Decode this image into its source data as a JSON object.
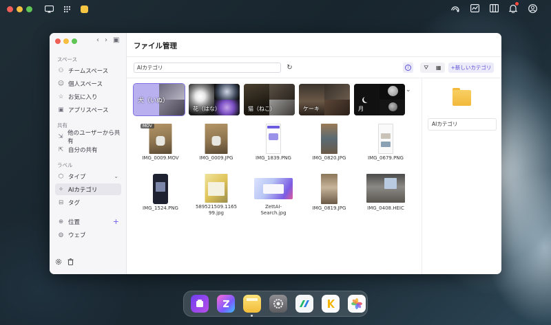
{
  "menubar": {
    "icons_left": [
      "window-icon",
      "grid-icon",
      "notes-icon"
    ],
    "icons_right": [
      "cloud-sync-icon",
      "chart-icon",
      "columns-icon",
      "bell-icon",
      "account-icon"
    ]
  },
  "window": {
    "title": "ファイル管理",
    "nav_back": "‹",
    "nav_forward": "›",
    "nav_panel": "▣"
  },
  "sidebar": {
    "spaces_header": "スペース",
    "spaces": [
      {
        "label": "チームスペース",
        "icon": "users-icon",
        "glyph": "⚇"
      },
      {
        "label": "個人スペース",
        "icon": "person-icon",
        "glyph": "☺"
      },
      {
        "label": "お気に入り",
        "icon": "star-icon",
        "glyph": "☆"
      },
      {
        "label": "アプリスペース",
        "icon": "app-icon",
        "glyph": "▣"
      }
    ],
    "shared_header": "共有",
    "shared": [
      {
        "label": "他のユーザーから共有",
        "icon": "share-in-icon",
        "glyph": "⇲"
      },
      {
        "label": "自分の共有",
        "icon": "share-out-icon",
        "glyph": "⇱"
      }
    ],
    "label_header": "ラベル",
    "labels": [
      {
        "label": "タイプ",
        "icon": "type-icon",
        "glyph": "⬡",
        "suffix": "⌄"
      },
      {
        "label": "AIカテゴリ",
        "icon": "ai-sparkle-icon",
        "glyph": "✧"
      },
      {
        "label": "タグ",
        "icon": "tag-icon",
        "glyph": "⊟"
      }
    ],
    "locations": [
      {
        "label": "位置",
        "icon": "location-icon",
        "glyph": "⊕",
        "suffix": "+"
      },
      {
        "label": "ウェブ",
        "icon": "globe-icon",
        "glyph": "◍"
      }
    ],
    "bottom_icons": [
      "settings-icon",
      "trash-icon"
    ]
  },
  "toolbar": {
    "search_value": "AIカテゴリ",
    "reload_glyph": "↻",
    "info_glyph": "i",
    "filter_glyph": "⛛",
    "grid_glyph": "▦",
    "new_category_label": "+新しいカテゴリ"
  },
  "categories": [
    {
      "label": "犬（いぬ）",
      "selected": true
    },
    {
      "label": "花（はな）",
      "selected": false
    },
    {
      "label": "猫（ねこ）",
      "selected": false
    },
    {
      "label": "ケーキ",
      "selected": false
    },
    {
      "label": "月",
      "selected": false
    }
  ],
  "categories_more": "⌄",
  "files": [
    {
      "name": "IMG_0009.MOV",
      "badge": "MOV",
      "kind": "dog-photo"
    },
    {
      "name": "IMG_0009.JPG",
      "kind": "dog-photo"
    },
    {
      "name": "IMG_1839.PNG",
      "kind": "screenshot"
    },
    {
      "name": "IMG_0820.JPG",
      "kind": "portrait-photo"
    },
    {
      "name": "IMG_0679.PNG",
      "kind": "screenshot"
    },
    {
      "name": "IMG_1524.PNG",
      "kind": "phone-dark"
    },
    {
      "name": "589521509.1165\n99.jpg",
      "kind": "document-photo"
    },
    {
      "name": "ZettAI-\nSearch.jpg",
      "kind": "web-banner"
    },
    {
      "name": "IMG_0819.JPG",
      "kind": "portrait-photo"
    },
    {
      "name": "IMG_0408.HEIC",
      "kind": "room-photo"
    }
  ],
  "detail": {
    "name_value": "AIカテゴリ"
  },
  "dock": [
    "files-app-icon",
    "zettai-app-icon",
    "notes-app-icon",
    "settings-app-icon",
    "finance-app-icon",
    "keynote-app-icon",
    "photos-app-icon"
  ]
}
